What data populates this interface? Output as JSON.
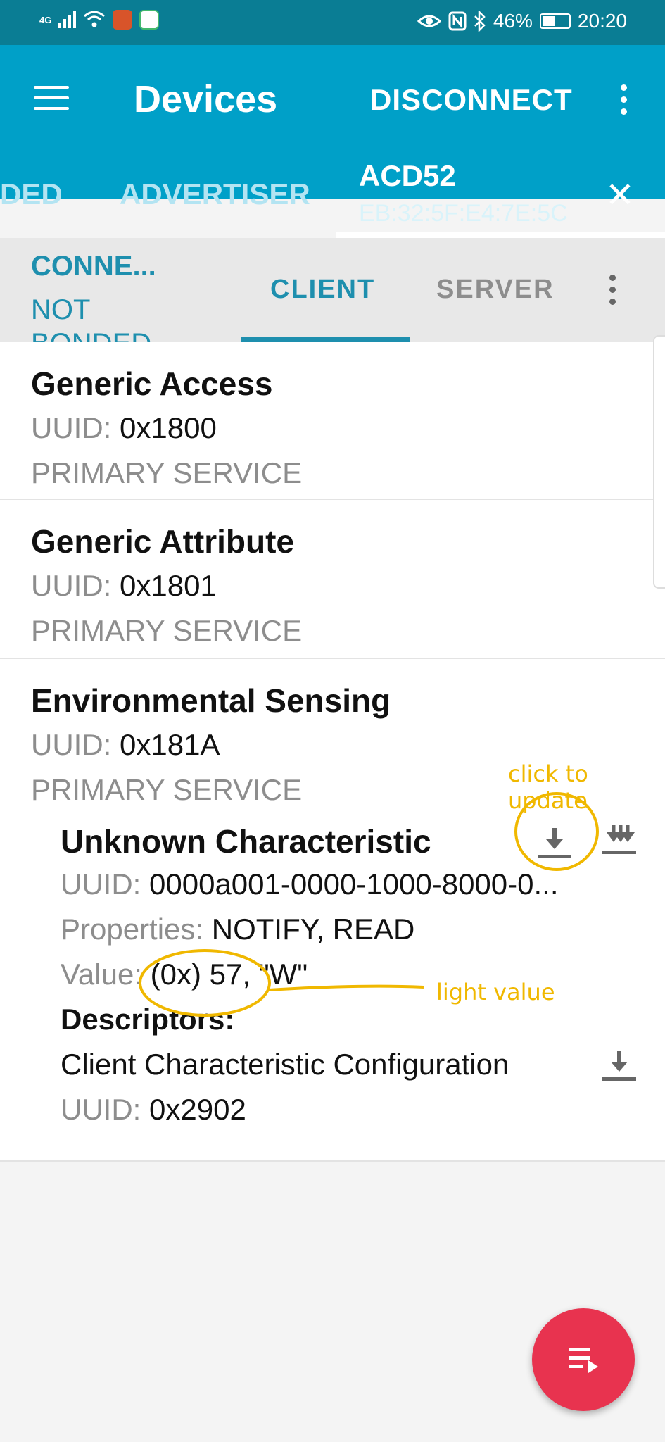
{
  "status_bar": {
    "network": "4G",
    "battery": "46%",
    "time": "20:20"
  },
  "app_bar": {
    "title": "Devices",
    "disconnect_label": "DISCONNECT"
  },
  "device_tabs": {
    "partial_tab": "DED",
    "advertiser": "ADVERTISER",
    "device_name": "ACD52",
    "device_mac": "EB:32:5F:E4:7E:5C"
  },
  "connection_tabs": {
    "connection_state": "CONNE...",
    "bond_state": "NOT BONDED",
    "client": "CLIENT",
    "server": "SERVER"
  },
  "uuid_label": "UUID:",
  "services": [
    {
      "name": "Generic Access",
      "uuid": "0x1800",
      "type": "PRIMARY SERVICE"
    },
    {
      "name": "Generic Attribute",
      "uuid": "0x1801",
      "type": "PRIMARY SERVICE"
    },
    {
      "name": "Environmental Sensing",
      "uuid": "0x181A",
      "type": "PRIMARY SERVICE"
    }
  ],
  "characteristic": {
    "name": "Unknown Characteristic",
    "uuid": "0000a001-0000-1000-8000-0...",
    "properties_label": "Properties:",
    "properties": "NOTIFY, READ",
    "value_label": "Value:",
    "value": "(0x) 57, \"W\"",
    "descriptors_label": "Descriptors:",
    "descriptor_name": "Client Characteristic Configuration",
    "descriptor_uuid": "0x2902"
  },
  "annotations": {
    "click_to_update": "click to update",
    "light_value": "light value",
    "color": "#f0b800"
  },
  "colors": {
    "primary": "#00a0c8",
    "status_bar": "#0a7d94",
    "accent": "#1e8fae",
    "fab": "#e8334f"
  }
}
